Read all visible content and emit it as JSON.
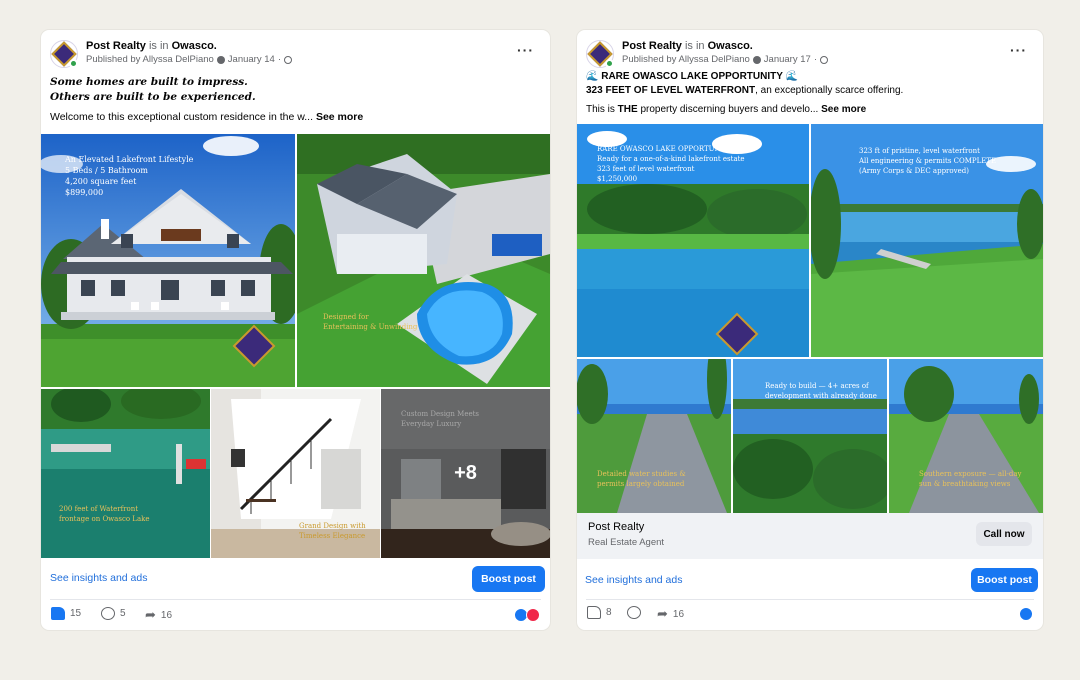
{
  "posts": [
    {
      "page_name": "Post Realty",
      "is_in_text": "is in",
      "location": "Owasco.",
      "published_by": "Published by Allyssa DelPiano",
      "date": "January 14",
      "headline_1": "Some homes are built to impress.",
      "headline_2": "Others are built to be experienced.",
      "body": "Welcome to this exceptional custom residence in the w...",
      "see_more": "See more",
      "tiles": [
        {
          "caption": "An Elevated Lakefront Lifestyle\n5 Beds / 5 Bathroom\n4,200 square feet\n$899,000"
        },
        {
          "caption": "Designed for\nEntertaining & Unwinding"
        },
        {
          "caption": "200 feet of Waterfront\nfrontage on Owasco Lake"
        },
        {
          "caption": "Grand Design with\nTimeless Elegance"
        },
        {
          "caption": "Custom Design Meets\nEveryday Luxury"
        }
      ],
      "more_count": "+8",
      "insights_link": "See insights and ads",
      "boost_label": "Boost post",
      "likes": "15",
      "comments": "5",
      "shares": "16"
    },
    {
      "page_name": "Post Realty",
      "is_in_text": "is in",
      "location": "Owasco.",
      "published_by": "Published by Allyssa DelPiano",
      "date": "January 17",
      "headline_1": "🌊 RARE OWASCO LAKE OPPORTUNITY 🌊",
      "headline_2_bold": "323 FEET OF LEVEL WATERFRONT",
      "headline_2_rest": ", an exceptionally scarce offering.",
      "body_prefix": "This is ",
      "body_bold": "THE",
      "body_rest": " property discerning buyers and develo...",
      "see_more": "See more",
      "tiles": [
        {
          "caption": "RARE OWASCO LAKE OPPORTUNITY\nReady for a one-of-a-kind lakefront estate\n323 feet of level waterfront\n$1,250,000"
        },
        {
          "caption": "323 ft of pristine, level waterfront\nAll engineering & permits COMPLETE\n(Army Corps & DEC approved)"
        },
        {
          "caption": "Detailed water studies &\npermits largely obtained"
        },
        {
          "caption": "Ready to build — 4+ acres of\ndevelopment with already done"
        },
        {
          "caption": "Southern exposure — all-day\nsun & breathtaking views"
        }
      ],
      "business_name": "Post Realty",
      "business_category": "Real Estate Agent",
      "call_label": "Call now",
      "insights_link": "See insights and ads",
      "boost_label": "Boost post",
      "likes": "8",
      "shares": "16"
    }
  ],
  "colors": {
    "accent": "#1877f2",
    "link": "#216fdb",
    "muted": "#65676b",
    "page_bg": "#f1efe9"
  }
}
